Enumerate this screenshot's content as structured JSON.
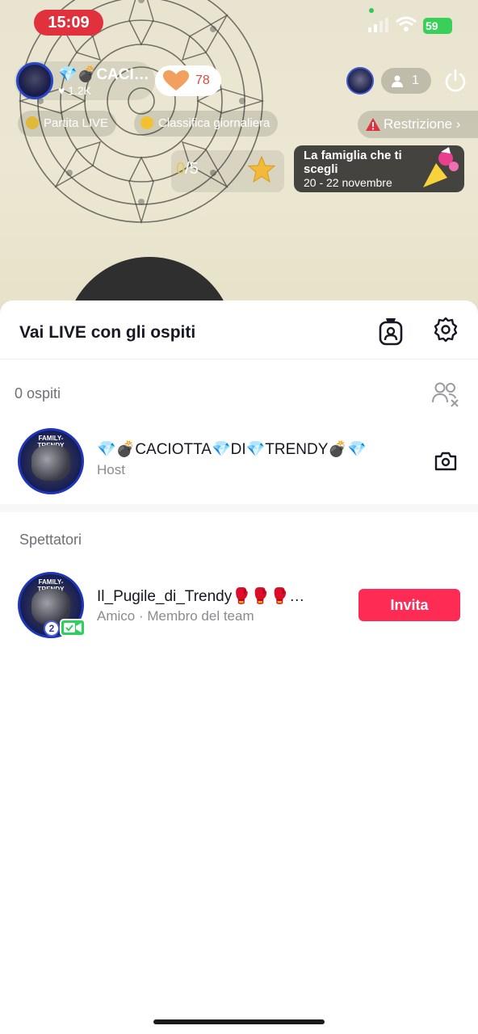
{
  "status_bar": {
    "time": "15:09",
    "battery": "59"
  },
  "live": {
    "host_name": "💎💣CACI…",
    "host_likes": "♥ 1.2K",
    "hearts": "78",
    "viewers": "1",
    "chips": {
      "partita": "Partita LIVE",
      "classifica": "Classifica giornaliera",
      "restrizione": "Restrizione"
    },
    "progress": {
      "done": "0",
      "total": "/5"
    },
    "event": {
      "title": "La famiglia che ti scegli",
      "dates": "20 - 22 novembre"
    }
  },
  "sheet": {
    "title": "Vai LIVE con gli ospiti",
    "guests_count": "0 ospiti",
    "host_row": {
      "name": "💎💣CACIOTTA💎DI💎TRENDY💣💎",
      "role": "Host",
      "avatar_text": "FAMILY-TRENDY"
    },
    "spectators_header": "Spettatori",
    "viewer_row": {
      "name": "Il_Pugile_di_Trendy🥊🥊🥊…",
      "sub": "Amico · Membro del team",
      "level": "2",
      "avatar_text": "FAMILY-TRENDY",
      "invite_label": "Invita"
    }
  },
  "colors": {
    "accent": "#fe2c55",
    "time_pill": "#e0313d",
    "battery": "#39d05a"
  },
  "icons": [
    "signal-icon",
    "wifi-icon",
    "heart-icon",
    "person-icon",
    "power-icon",
    "warning-icon",
    "star-icon",
    "badge-icon",
    "gear-icon",
    "remove-guests-icon",
    "flip-camera-icon",
    "video-camera-icon"
  ]
}
